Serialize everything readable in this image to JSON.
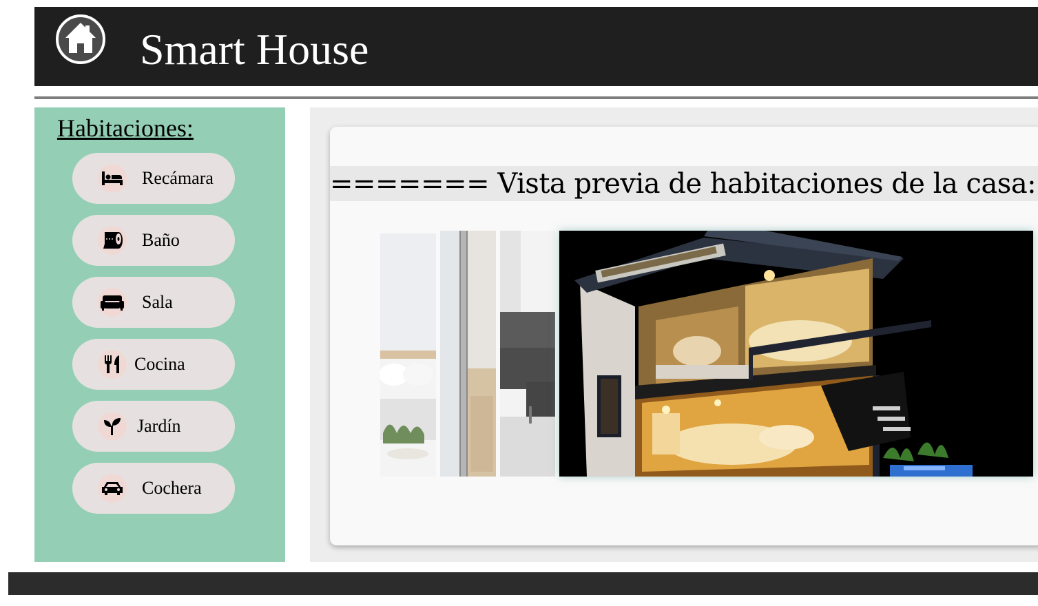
{
  "header": {
    "title": "Smart House",
    "logo_icon": "house-icon"
  },
  "sidebar": {
    "heading": "Habitaciones:",
    "items": [
      {
        "label": "Recámara",
        "icon": "bed-icon"
      },
      {
        "label": "Baño",
        "icon": "toilet-paper-icon"
      },
      {
        "label": "Sala",
        "icon": "couch-icon"
      },
      {
        "label": "Cocina",
        "icon": "utensils-icon"
      },
      {
        "label": "Jardín",
        "icon": "seedling-icon"
      },
      {
        "label": "Cochera",
        "icon": "car-icon"
      }
    ]
  },
  "main": {
    "preview_title": "======= Vista previa de habitaciones de la casa:"
  },
  "colors": {
    "header_bg": "#1f1f1f",
    "sidebar_bg": "#94cfb5",
    "button_bg": "#e6e1e0",
    "icon_bg": "#f0d9d4",
    "footer_bg": "#2c2c2c"
  }
}
